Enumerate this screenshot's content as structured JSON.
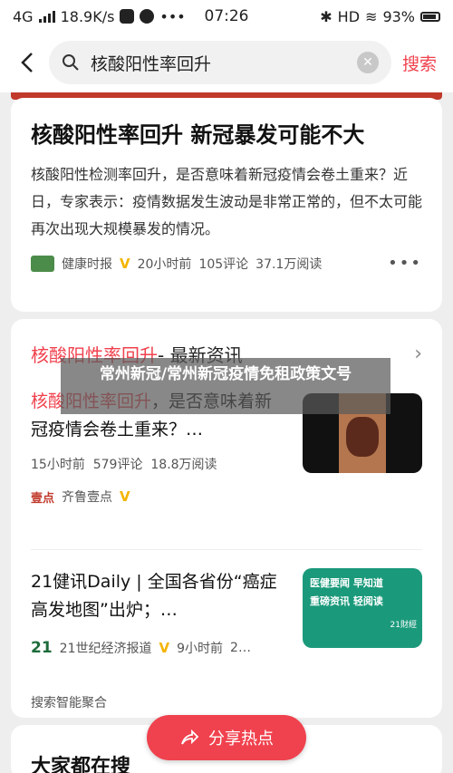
{
  "status_bar": {
    "network": "4G",
    "speed": "18.9K/s",
    "time": "07:26",
    "hd": "HD",
    "battery": "93%"
  },
  "search": {
    "query": "核酸阳性率回升",
    "button_label": "搜索"
  },
  "top_card": {
    "title": "核酸阳性率回升 新冠暴发可能不大",
    "summary": "核酸阳性检测率回升，是否意味着新冠疫情会卷土重来？近日，专家表示：疫情数据发生波动是非常正常的，但不太可能再次出现大规模暴发的情况。",
    "source": "健康时报",
    "time": "20小时前",
    "comments": "105评论",
    "reads": "37.1万阅读"
  },
  "news_card": {
    "header_highlight": "核酸阳性率回升",
    "header_rest": " - 最新资讯",
    "item1": {
      "title_highlight": "核酸阳性率回升",
      "title_rest": "，是否意味着新冠疫情会卷土重来？…",
      "time": "15小时前",
      "comments": "579评论",
      "reads": "18.8万阅读",
      "source_logo": "壹点",
      "source": "齐鲁壹点"
    },
    "item2": {
      "title": "21健讯Daily | 全国各省份“癌症高发地图”出炉；…",
      "source_logo": "21",
      "source": "21世纪经济报道",
      "time": "9小时前",
      "extra": "2…",
      "thumb_line1": "医健要闻 早知道",
      "thumb_line2": "重磅资讯 轻阅读",
      "thumb_logo": "21財經"
    },
    "footer": "搜索智能聚合"
  },
  "bottom_card": {
    "title": "大家都在搜"
  },
  "share_button": "分享热点",
  "overlay_text": "常州新冠/常州新冠疫情免租政策文号",
  "colors": {
    "accent": "#f0424e",
    "verified": "#f5b400"
  }
}
